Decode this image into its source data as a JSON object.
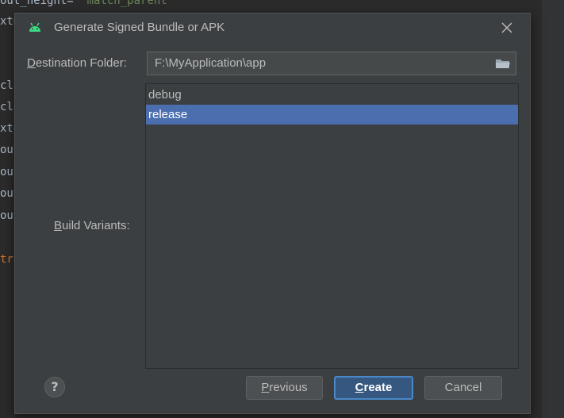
{
  "background_editor": {
    "lines": [
      {
        "text": "out_height=",
        "value": "\"match_parent\""
      },
      {
        "text": "xt="
      },
      {
        "text": "cla"
      },
      {
        "text": "cla"
      },
      {
        "text": "xto"
      },
      {
        "text": "out"
      },
      {
        "text": "out"
      },
      {
        "text": "out"
      },
      {
        "text": "out"
      },
      {
        "text": "tra"
      }
    ]
  },
  "dialog": {
    "title": "Generate Signed Bundle or APK",
    "title_icon": "android-icon",
    "close_icon": "close-icon",
    "destination": {
      "label_mnemonic": "D",
      "label_rest": "estination Folder:",
      "value": "F:\\MyApplication\\app",
      "browse_icon": "folder-icon"
    },
    "build_variants": {
      "label_mnemonic": "B",
      "label_rest": "uild Variants:",
      "items": [
        "debug",
        "release"
      ],
      "selected": "release"
    },
    "buttons": {
      "help": "?",
      "previous_mnemonic": "P",
      "previous_rest": "revious",
      "create_mnemonic": "C",
      "create_rest": "reate",
      "cancel": "Cancel"
    }
  }
}
